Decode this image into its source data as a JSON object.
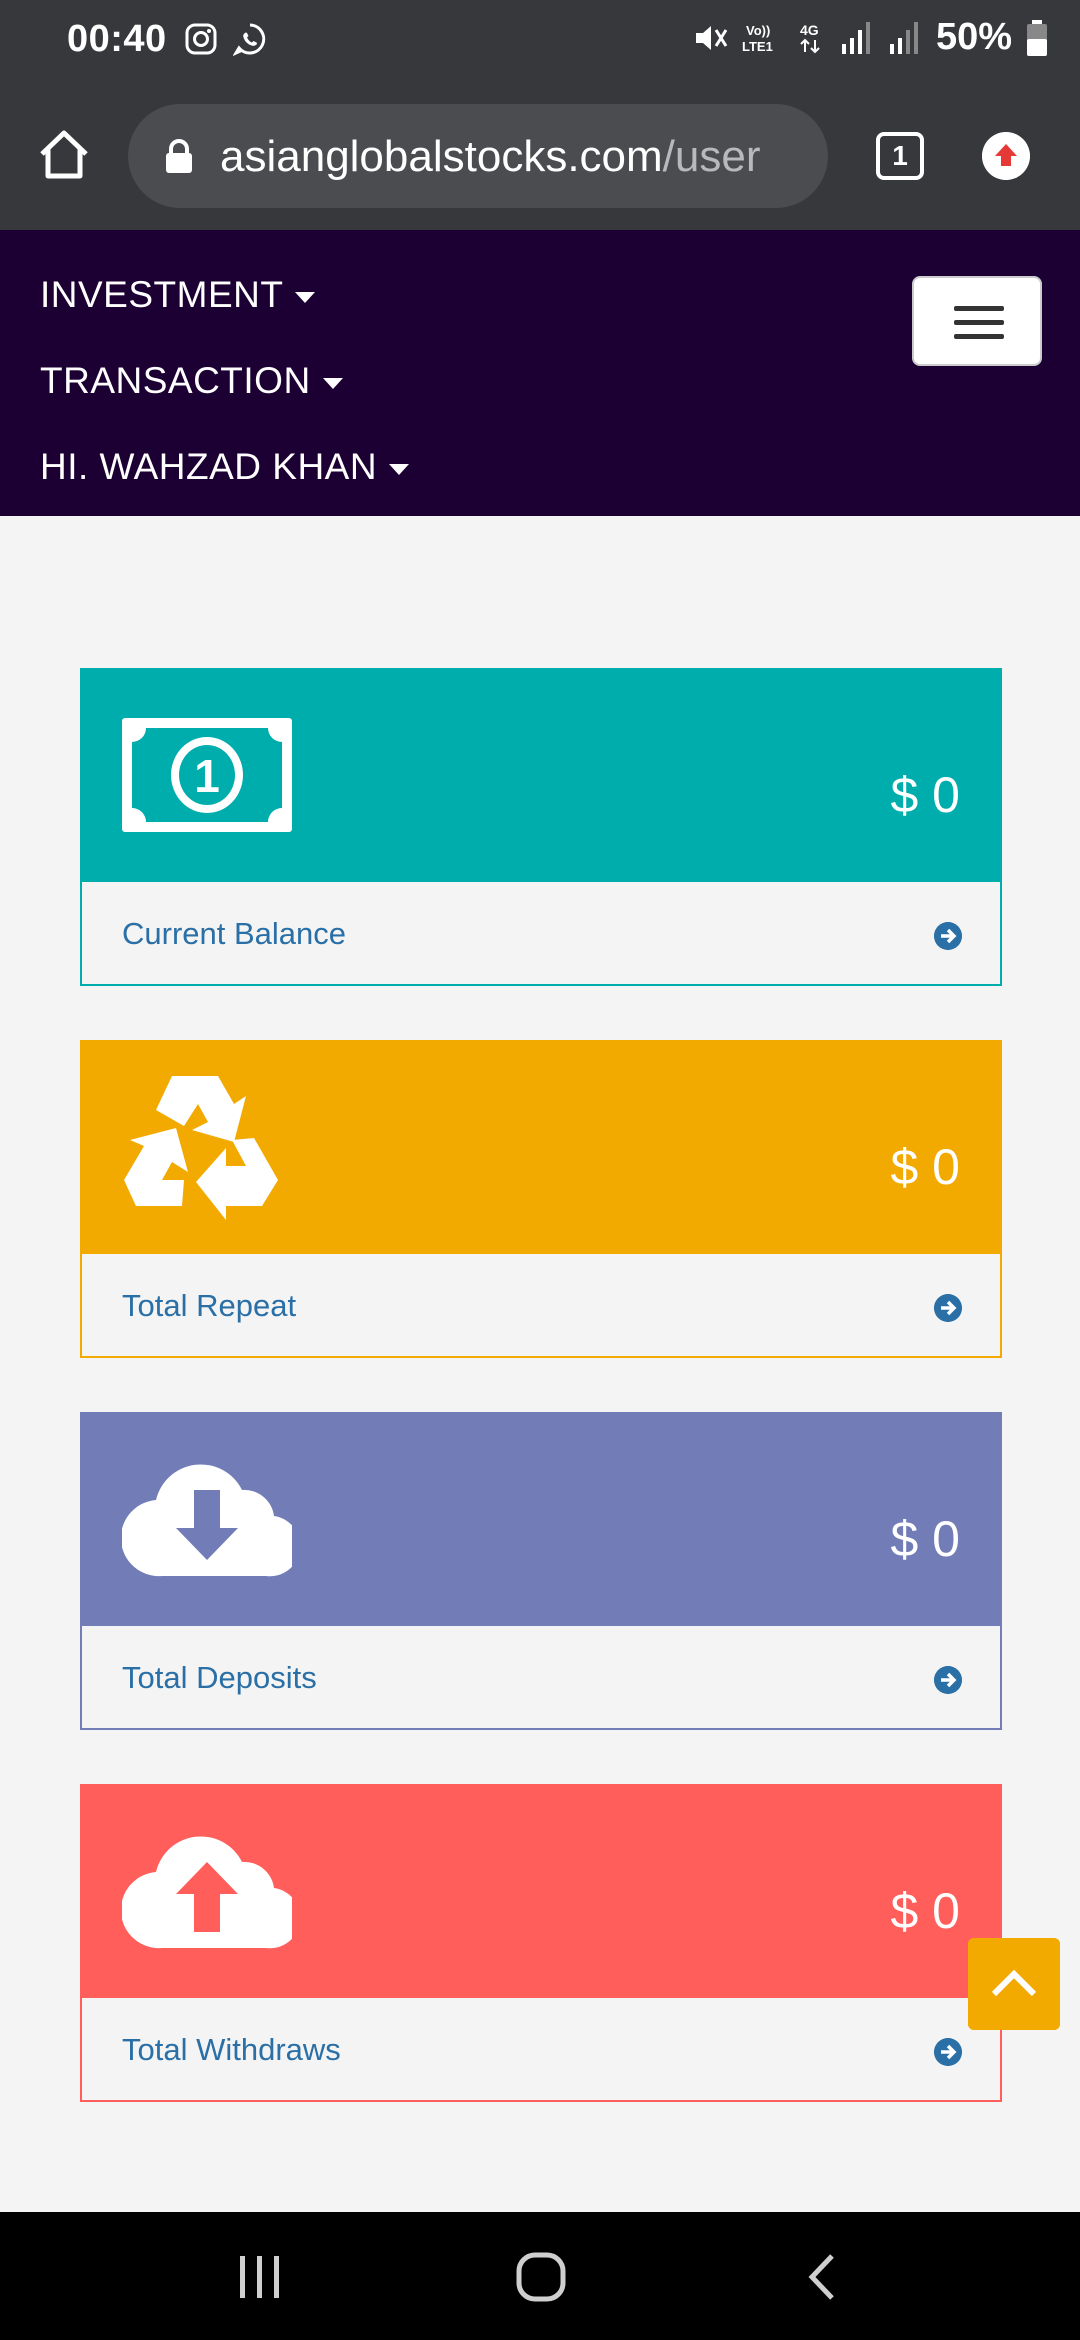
{
  "status_bar": {
    "time": "00:40",
    "app_icons": [
      "instagram-icon",
      "whatsapp-icon"
    ],
    "indicators": [
      "mute-icon",
      "volte-icon",
      "4g-icon",
      "signal-icon",
      "signal-icon"
    ],
    "battery": "50%"
  },
  "browser": {
    "url_host": "asianglobalstocks.com",
    "url_path": "/user",
    "tab_count": "1"
  },
  "nav": {
    "items": [
      {
        "label": "INVESTMENT"
      },
      {
        "label": "TRANSACTION"
      },
      {
        "label": "HI. WAHZAD KHAN"
      }
    ]
  },
  "cards": [
    {
      "label": "Current Balance",
      "amount": "$ 0",
      "icon": "money-bill-icon",
      "color": "#00adad"
    },
    {
      "label": "Total Repeat",
      "amount": "$ 0",
      "icon": "recycle-icon",
      "color": "#f2a900"
    },
    {
      "label": "Total Deposits",
      "amount": "$ 0",
      "icon": "cloud-download-icon",
      "color": "#727db8"
    },
    {
      "label": "Total Withdraws",
      "amount": "$ 0",
      "icon": "cloud-upload-icon",
      "color": "#ff5e5b"
    }
  ],
  "colors": {
    "status_bar": "#36383b",
    "site_nav": "#1c0033",
    "link": "#2a6fa6",
    "back_to_top": "#f2a900"
  }
}
